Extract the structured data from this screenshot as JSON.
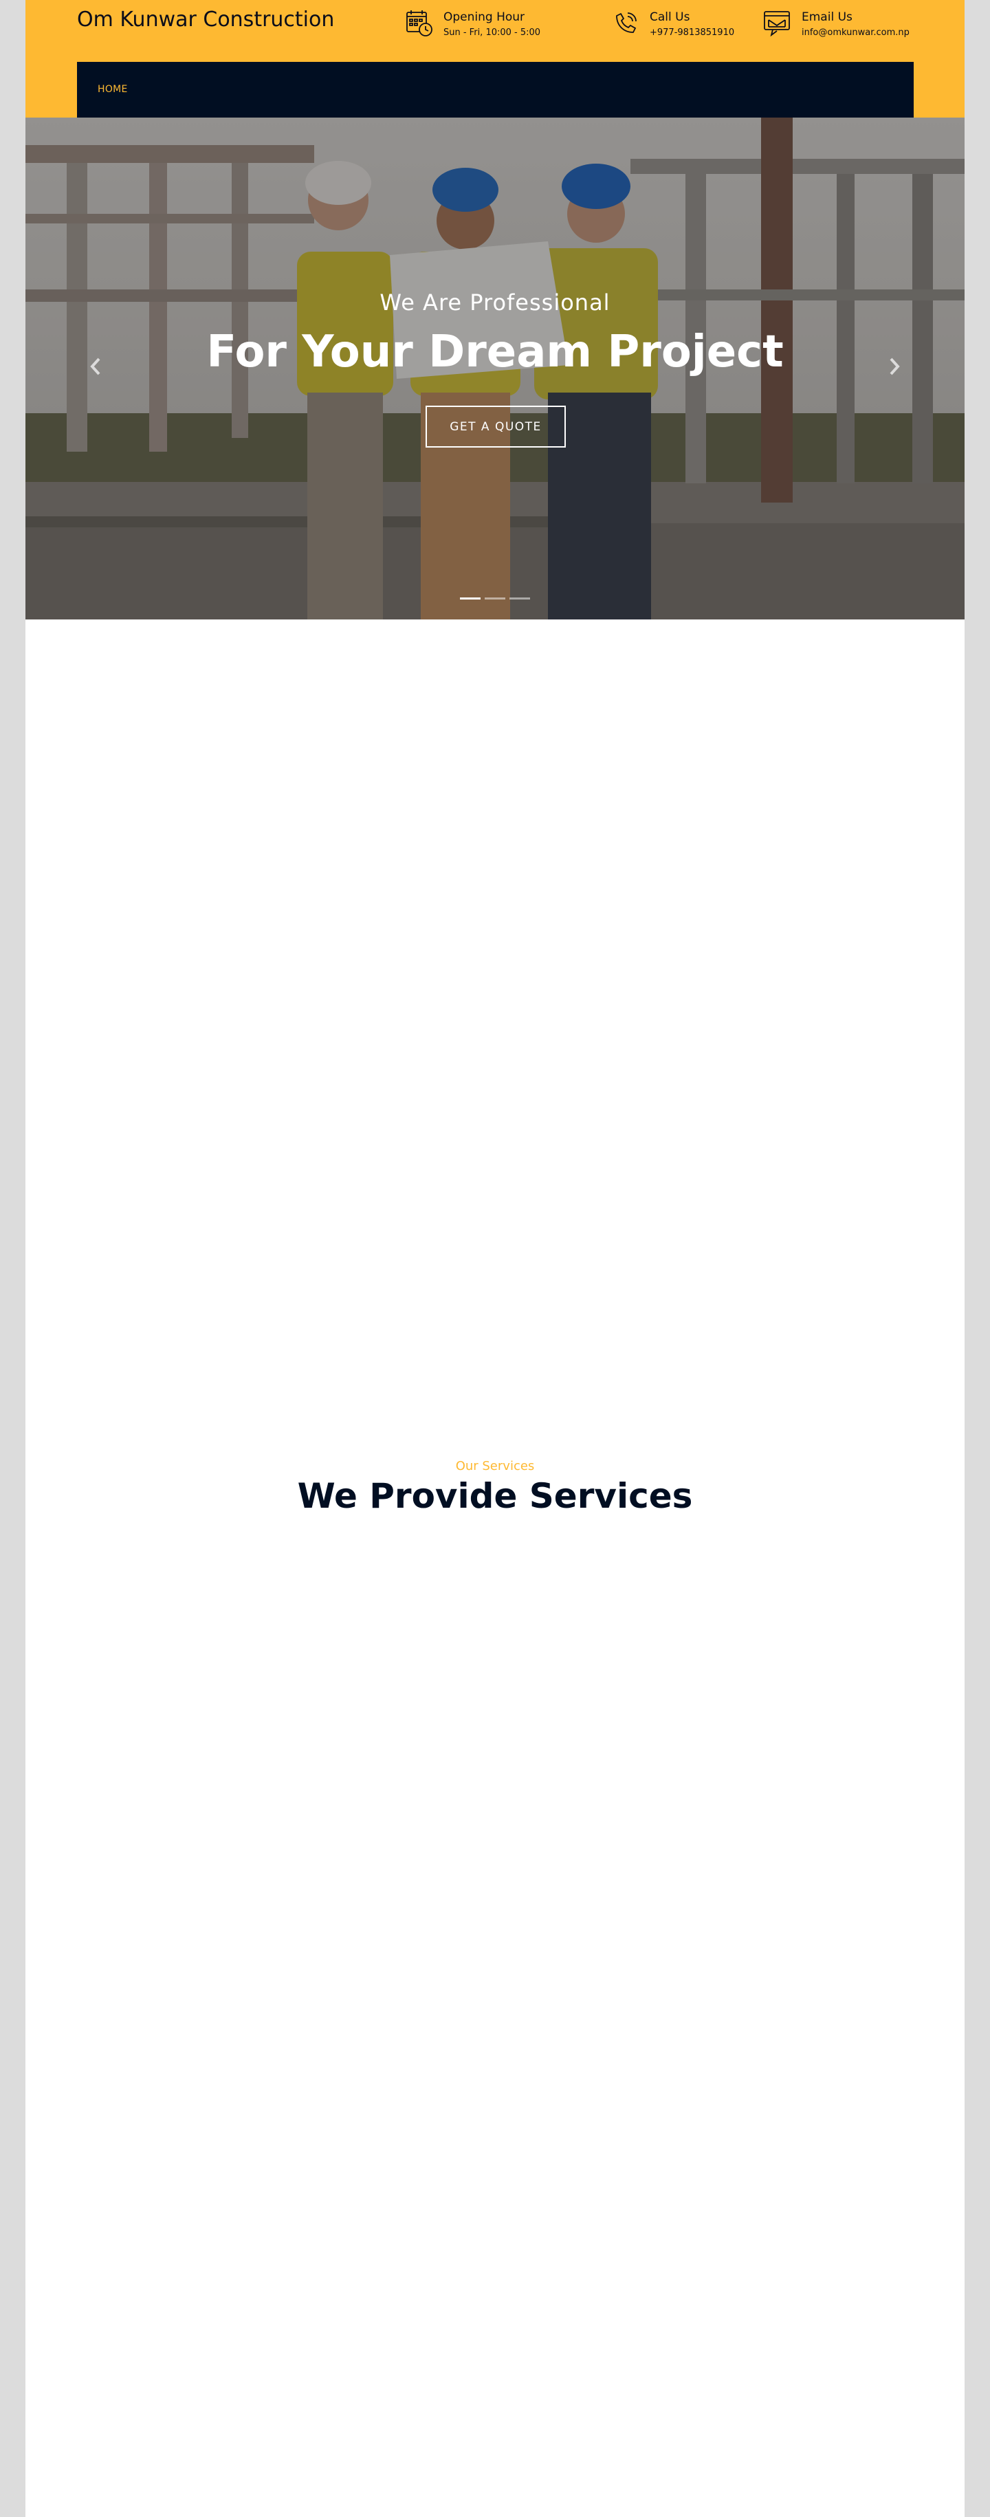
{
  "header": {
    "brand": "Om Kunwar Construction",
    "hours": {
      "title": "Opening Hour",
      "value": "Sun - Fri, 10:00 - 5:00",
      "icon": "calendar-clock-icon"
    },
    "call": {
      "title": "Call Us",
      "value": "+977-9813851910",
      "icon": "phone-icon"
    },
    "email": {
      "title": "Email Us",
      "value": "info@omkunwar.com.np",
      "icon": "email-icon"
    }
  },
  "nav": {
    "items": [
      {
        "label": "HOME"
      }
    ]
  },
  "hero": {
    "subtitle": "We Are Professional",
    "title": "For Your Dream Project",
    "cta": "GET A QUOTE",
    "slide_count": 3,
    "active_slide": 0
  },
  "services": {
    "eyebrow": "Our Services",
    "title": "We Provide Services"
  },
  "colors": {
    "accent": "#feb932",
    "dark_navy": "#010e22",
    "page_bg": "#dcdcdc"
  }
}
